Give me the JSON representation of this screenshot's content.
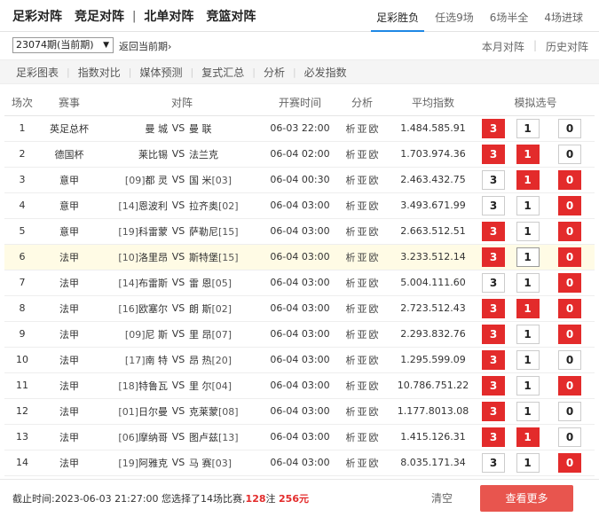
{
  "nav": {
    "items": [
      "足彩对阵",
      "竞足对阵",
      "北单对阵",
      "竞篮对阵"
    ],
    "divider": "|",
    "tabs": [
      "足彩胜负",
      "任选9场",
      "6场半全",
      "4场进球"
    ]
  },
  "toolbar": {
    "issue_select": "23074期(当前期)",
    "back_link": "返回当前期›",
    "month_link": "本月对阵",
    "history_link": "历史对阵"
  },
  "subnav": [
    "足彩图表",
    "指数对比",
    "媒体预测",
    "复式汇总",
    "分析",
    "必发指数"
  ],
  "table": {
    "headers": [
      "场次",
      "赛事",
      "对阵",
      "开赛时间",
      "分析",
      "平均指数",
      "模拟选号"
    ],
    "vs": "VS",
    "analysis": [
      "析",
      "亚",
      "欧"
    ],
    "rows": [
      {
        "no": "1",
        "league": "英足总杯",
        "home_rank": "",
        "home": "曼 城",
        "away": "曼 联",
        "away_rank": "",
        "time": "06-03 22:00",
        "odds": [
          "1.48",
          "4.58",
          "5.91"
        ],
        "picks": [
          "3",
          "1",
          "0"
        ],
        "selected": [
          true,
          false,
          false
        ]
      },
      {
        "no": "2",
        "league": "德国杯",
        "home_rank": "",
        "home": "莱比锡",
        "away": "法兰克",
        "away_rank": "",
        "time": "06-04 02:00",
        "odds": [
          "1.70",
          "3.97",
          "4.36"
        ],
        "picks": [
          "3",
          "1",
          "0"
        ],
        "selected": [
          true,
          true,
          false
        ]
      },
      {
        "no": "3",
        "league": "意甲",
        "home_rank": "[09]",
        "home": "都 灵",
        "away": "国 米",
        "away_rank": "[03]",
        "time": "06-04 00:30",
        "odds": [
          "2.46",
          "3.43",
          "2.75"
        ],
        "picks": [
          "3",
          "1",
          "0"
        ],
        "selected": [
          false,
          true,
          true
        ]
      },
      {
        "no": "4",
        "league": "意甲",
        "home_rank": "[14]",
        "home": "恩波利",
        "away": "拉齐奥",
        "away_rank": "[02]",
        "time": "06-04 03:00",
        "odds": [
          "3.49",
          "3.67",
          "1.99"
        ],
        "picks": [
          "3",
          "1",
          "0"
        ],
        "selected": [
          false,
          false,
          true
        ]
      },
      {
        "no": "5",
        "league": "意甲",
        "home_rank": "[19]",
        "home": "科雷蒙",
        "away": "萨勒尼",
        "away_rank": "[15]",
        "time": "06-04 03:00",
        "odds": [
          "2.66",
          "3.51",
          "2.51"
        ],
        "picks": [
          "3",
          "1",
          "0"
        ],
        "selected": [
          true,
          false,
          true
        ]
      },
      {
        "no": "6",
        "league": "法甲",
        "home_rank": "[10]",
        "home": "洛里昂",
        "away": "斯特堡",
        "away_rank": "[15]",
        "time": "06-04 03:00",
        "odds": [
          "3.23",
          "3.51",
          "2.14"
        ],
        "picks": [
          "3",
          "1",
          "0"
        ],
        "selected": [
          true,
          false,
          true
        ],
        "highlight": true
      },
      {
        "no": "7",
        "league": "法甲",
        "home_rank": "[14]",
        "home": "布雷斯",
        "away": "雷 恩",
        "away_rank": "[05]",
        "time": "06-04 03:00",
        "odds": [
          "5.00",
          "4.11",
          "1.60"
        ],
        "picks": [
          "3",
          "1",
          "0"
        ],
        "selected": [
          false,
          false,
          true
        ]
      },
      {
        "no": "8",
        "league": "法甲",
        "home_rank": "[16]",
        "home": "欧塞尔",
        "away": "朗 斯",
        "away_rank": "[02]",
        "time": "06-04 03:00",
        "odds": [
          "2.72",
          "3.51",
          "2.43"
        ],
        "picks": [
          "3",
          "1",
          "0"
        ],
        "selected": [
          true,
          true,
          true
        ]
      },
      {
        "no": "9",
        "league": "法甲",
        "home_rank": "[09]",
        "home": "尼 斯",
        "away": "里 昂",
        "away_rank": "[07]",
        "time": "06-04 03:00",
        "odds": [
          "2.29",
          "3.83",
          "2.76"
        ],
        "picks": [
          "3",
          "1",
          "0"
        ],
        "selected": [
          true,
          false,
          true
        ]
      },
      {
        "no": "10",
        "league": "法甲",
        "home_rank": "[17]",
        "home": "南 特",
        "away": "昂 热",
        "away_rank": "[20]",
        "time": "06-04 03:00",
        "odds": [
          "1.29",
          "5.59",
          "9.09"
        ],
        "picks": [
          "3",
          "1",
          "0"
        ],
        "selected": [
          true,
          false,
          false
        ]
      },
      {
        "no": "11",
        "league": "法甲",
        "home_rank": "[18]",
        "home": "特鲁瓦",
        "away": "里 尔",
        "away_rank": "[04]",
        "time": "06-04 03:00",
        "odds": [
          "10.78",
          "6.75",
          "1.22"
        ],
        "picks": [
          "3",
          "1",
          "0"
        ],
        "selected": [
          true,
          false,
          true
        ]
      },
      {
        "no": "12",
        "league": "法甲",
        "home_rank": "[01]",
        "home": "日尔曼",
        "away": "克莱蒙",
        "away_rank": "[08]",
        "time": "06-04 03:00",
        "odds": [
          "1.17",
          "7.80",
          "13.08"
        ],
        "picks": [
          "3",
          "1",
          "0"
        ],
        "selected": [
          true,
          false,
          false
        ]
      },
      {
        "no": "13",
        "league": "法甲",
        "home_rank": "[06]",
        "home": "摩纳哥",
        "away": "图卢兹",
        "away_rank": "[13]",
        "time": "06-04 03:00",
        "odds": [
          "1.41",
          "5.12",
          "6.31"
        ],
        "picks": [
          "3",
          "1",
          "0"
        ],
        "selected": [
          true,
          true,
          false
        ]
      },
      {
        "no": "14",
        "league": "法甲",
        "home_rank": "[19]",
        "home": "阿雅克",
        "away": "马 赛",
        "away_rank": "[03]",
        "time": "06-04 03:00",
        "odds": [
          "8.03",
          "5.17",
          "1.34"
        ],
        "picks": [
          "3",
          "1",
          "0"
        ],
        "selected": [
          false,
          false,
          true
        ]
      }
    ]
  },
  "footer": {
    "deadline": "截止时间:2023-06-03 21:27:00",
    "selected_text": "您选择了14场比赛,",
    "notes_count": "128",
    "notes_unit": "注",
    "amount": "256元",
    "clear_label": "清空",
    "more_label": "查看更多"
  },
  "colors": {
    "accent": "#1e88e5",
    "pick_on": "#e32b2b",
    "highlight_row": "#fffbe5",
    "more_button": "#e8554e"
  }
}
